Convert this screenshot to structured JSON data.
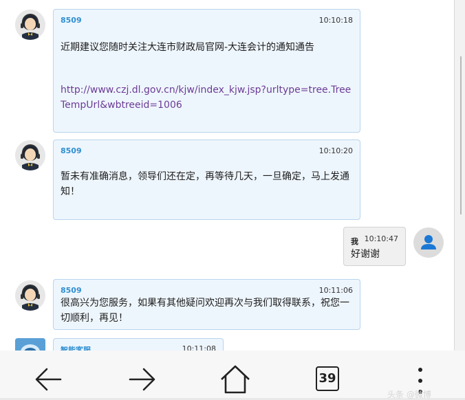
{
  "messages": [
    {
      "sender": "8509",
      "time": "10:10:18",
      "text": "近期建议您随时关注大连市财政局官网-大连会计的通知通告",
      "link": "http://www.czj.dl.gov.cn/kjw/index_kjw.jsp?urltype=tree.TreeTempUrl&wbtreeid=1006"
    },
    {
      "sender": "8509",
      "time": "10:10:20",
      "text": "暂未有准确消息，领导们还在定，再等待几天，一旦确定，马上发通知！"
    },
    {
      "sender": "我",
      "time": "10:10:47",
      "text": "好谢谢"
    },
    {
      "sender": "8509",
      "time": "10:11:06",
      "text": "很高兴为您服务，如果有其他疑问欢迎再次与我们取得联系，祝您一切顺利，再见！"
    },
    {
      "sender": "智能客服",
      "time": "10:11:08"
    }
  ],
  "navbar": {
    "back_icon": "arrow-left-icon",
    "forward_icon": "arrow-right-icon",
    "home_icon": "home-icon",
    "tab_count": "39",
    "menu_icon": "more-vertical-icon"
  },
  "watermark": "头条 @微博"
}
